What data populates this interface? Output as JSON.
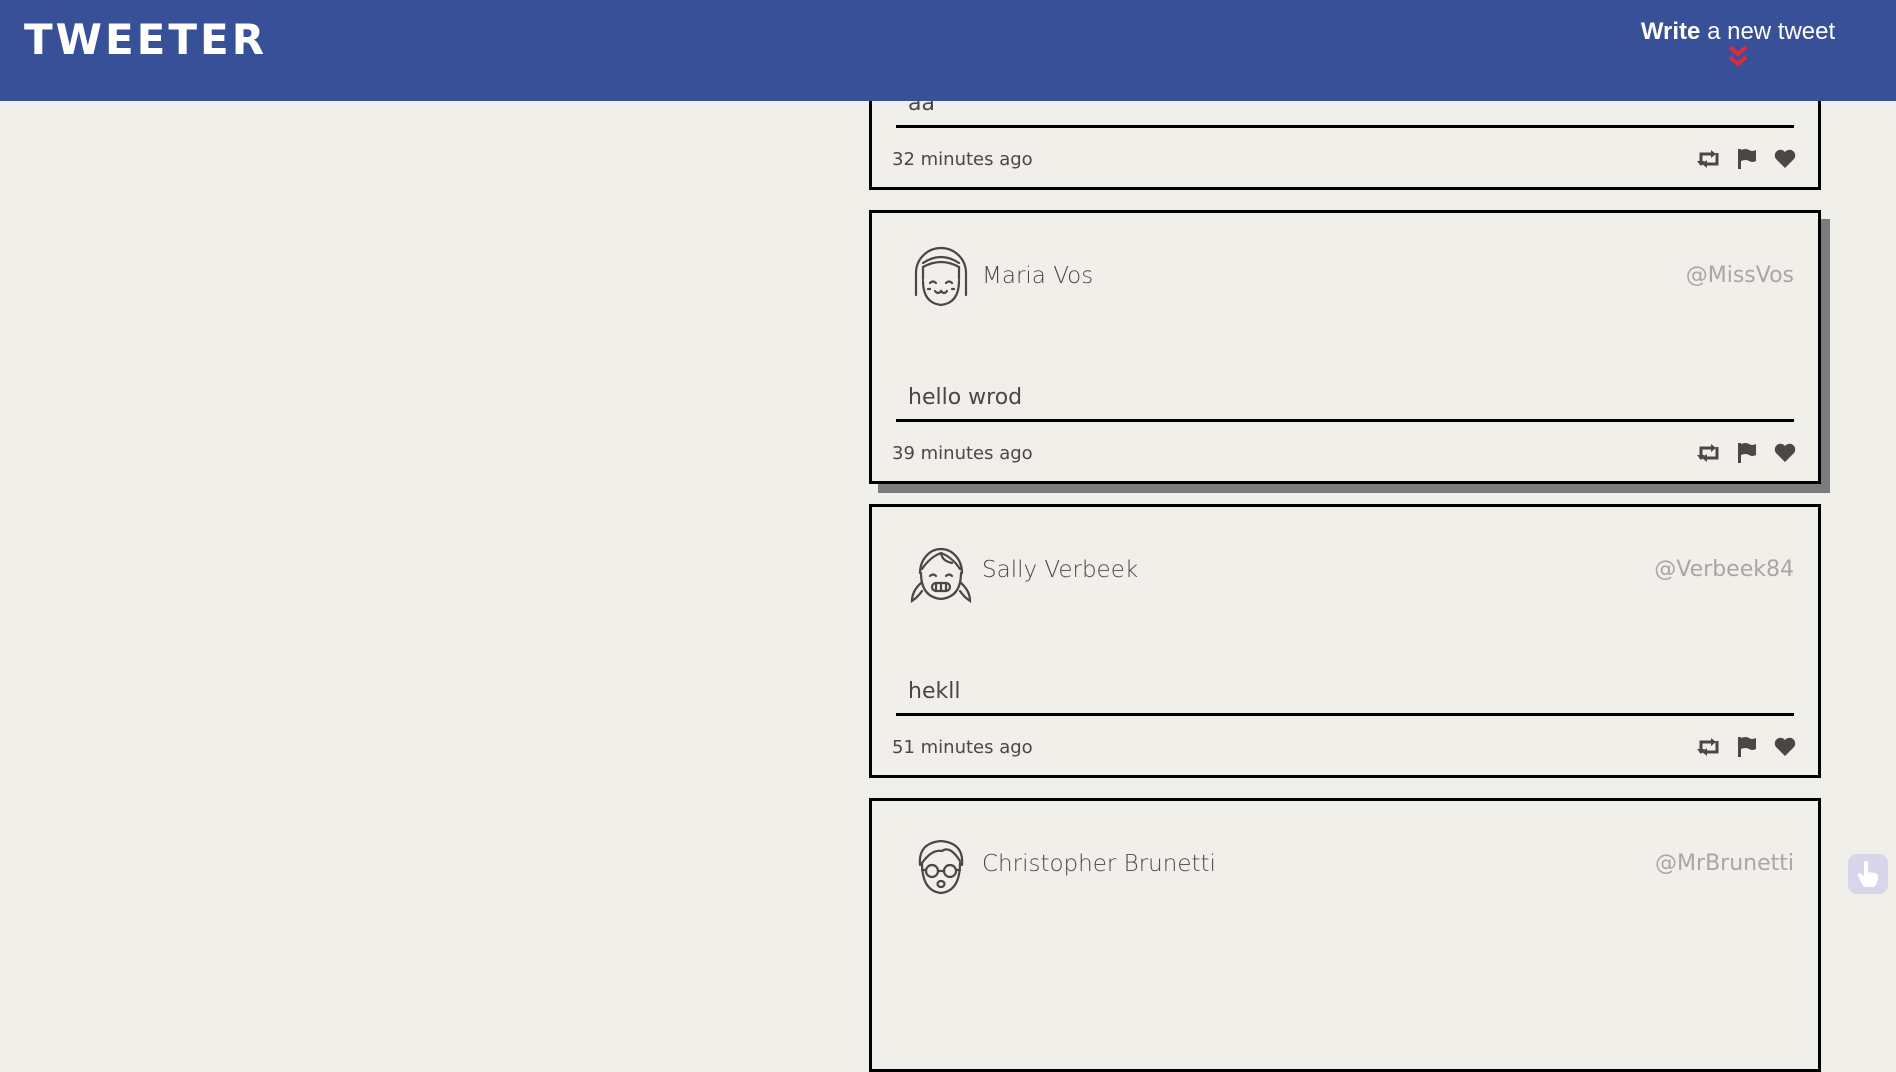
{
  "app": {
    "logo": "TWEETER"
  },
  "nav": {
    "compose_strong": "Write",
    "compose_rest": " a new tweet",
    "compose_arrow_color": "#e02a3a"
  },
  "colors": {
    "navbar": "#385097",
    "page_background": "#f1efe9",
    "card_border": "#000000",
    "hover_shadow": "#7c7c7c",
    "handle_text": "#a9a7a3"
  },
  "tweets": [
    {
      "name": "",
      "handle": "",
      "avatar": "",
      "text": "aa",
      "time": "32 minutes ago",
      "hovered": false
    },
    {
      "name": "Maria Vos",
      "handle": "@MissVos",
      "avatar": "girl-bangs-avatar-icon",
      "text": "hello wrod",
      "time": "39 minutes ago",
      "hovered": true
    },
    {
      "name": "Sally Verbeek",
      "handle": "@Verbeek84",
      "avatar": "girl-pigtails-avatar-icon",
      "text": "hekll",
      "time": "51 minutes ago",
      "hovered": false
    },
    {
      "name": "Christopher Brunetti",
      "handle": "@MrBrunetti",
      "avatar": "boy-glasses-avatar-icon",
      "text": "",
      "time": "",
      "hovered": false
    }
  ],
  "action_icons": [
    "retweet-icon",
    "flag-icon",
    "heart-icon"
  ],
  "floating_button": {
    "icon": "pointing-hand-icon"
  }
}
